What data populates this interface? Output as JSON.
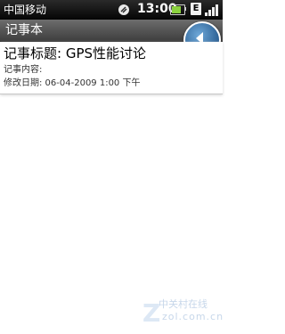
{
  "status_bar": {
    "carrier": "中国移动",
    "time": "13:00",
    "network_type": "E",
    "battery_level": 0.8
  },
  "title_bar": {
    "app_title": "记事本",
    "back_icon": "back-arrow-icon"
  },
  "note": {
    "title": "记事标题: GPS性能讨论",
    "content_label": "记事内容:",
    "modified": "修改日期: 06-04-2009 1:00 下午"
  },
  "watermark": {
    "cn": "中关村在线",
    "en": "zol.com.cn",
    "z": "Z"
  }
}
